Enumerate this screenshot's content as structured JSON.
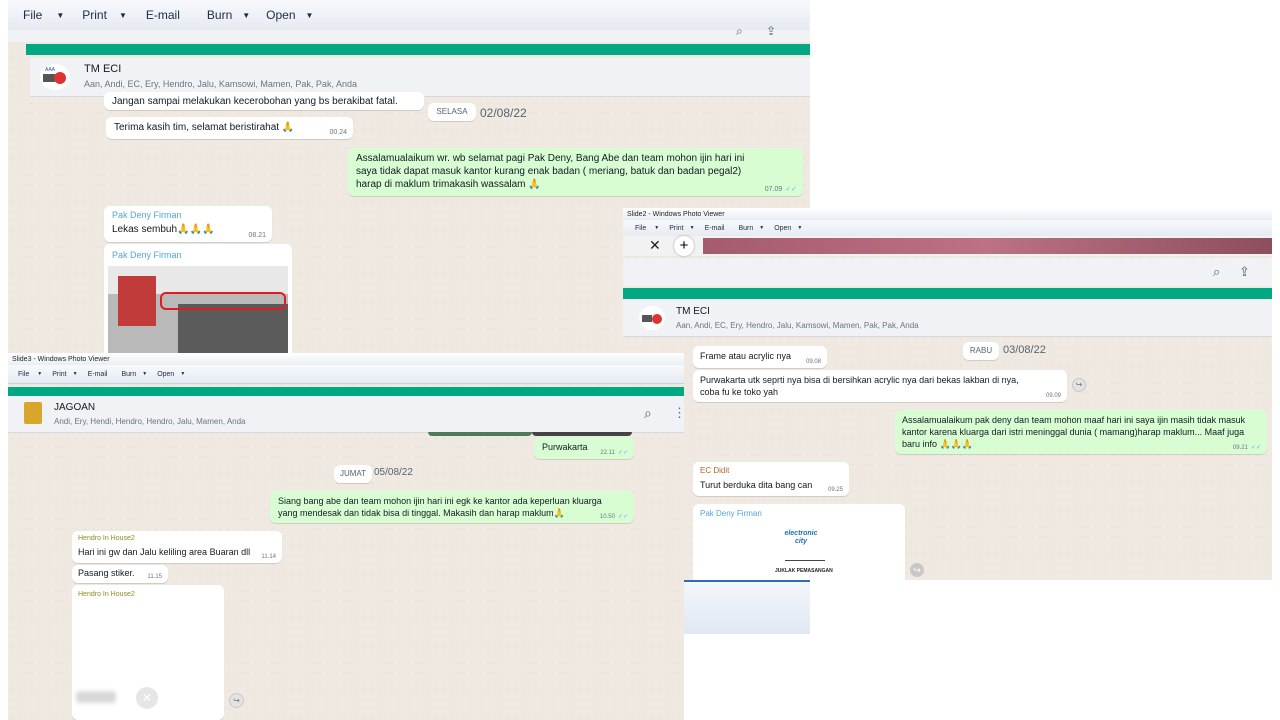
{
  "viewer1": {
    "toolbar": {
      "file": "File",
      "print": "Print",
      "email": "E-mail",
      "burn": "Burn",
      "open": "Open"
    },
    "group": {
      "name": "TM ECI",
      "members": "Aan, Andi, EC, Ery, Hendro, Jalu, Kamsowi, Mamen, Pak, Pak, Anda"
    },
    "messages": {
      "m0": {
        "text": "Jangan sampai melakukan kecerobohan yang bs berakibat fatal."
      },
      "day": {
        "label": "SELASA",
        "date": "02/08/22"
      },
      "m1": {
        "text": "Terima kasih tim, selamat beristirahat 🙏",
        "time": "00.24"
      },
      "m2": {
        "text": "Assalamualaikum wr. wb selamat pagi Pak Deny,  Bang Abe dan team mohon ijin hari ini saya tidak dapat masuk kantor kurang enak badan ( meriang,  batuk dan badan pegal2) harap di maklum trimakasih wassalam 🙏",
        "time": "07.09"
      },
      "m3": {
        "sender": "Pak Deny Firman",
        "text": "Lekas sembuh🙏🙏🙏",
        "time": "08.21"
      },
      "m4": {
        "sender": "Pak Deny Firman"
      }
    }
  },
  "viewer2": {
    "title": "Slide2 - Windows Photo Viewer",
    "toolbar": {
      "file": "File",
      "print": "Print",
      "email": "E-mail",
      "burn": "Burn",
      "open": "Open"
    },
    "group": {
      "name": "TM ECI",
      "members": "Aan, Andi, EC, Ery, Hendro, Jalu, Kamsowi, Mamen, Pak, Pak, Anda"
    },
    "messages": {
      "day": {
        "label": "RABU",
        "date": "03/08/22"
      },
      "m1": {
        "text": "Frame atau acrylic nya",
        "time": "09.08"
      },
      "m2": {
        "text": "Purwakarta utk seprti nya bisa di bersihkan acrylic nya dari bekas lakban di nya, coba fu ke toko yah",
        "time": "09.09"
      },
      "m3": {
        "text": "Assalamualaikum pak deny dan team mohon maaf hari ini saya ijin masih tidak masuk kantor karena kluarga dari istri meninggal dunia ( mamang)harap maklum... Maaf juga baru info 🙏🙏🙏",
        "time": "09.21"
      },
      "m4": {
        "sender": "EC Didit",
        "text": "Turut berduka dita bang can",
        "time": "09.25"
      },
      "m5": {
        "sender": "Pak Deny Firman",
        "logo": "electronic city",
        "caption": "JUKLAK PEMASANGAN"
      }
    }
  },
  "viewer3": {
    "title": "Slide3 - Windows Photo Viewer",
    "toolbar": {
      "file": "File",
      "print": "Print",
      "email": "E-mail",
      "burn": "Burn",
      "open": "Open"
    },
    "group": {
      "name": "JAGOAN",
      "members": "Andi, Ery, Hendi, Hendro, Hendro, Jalu, Mamen, Anda"
    },
    "messages": {
      "m0": {
        "text": "Purwakarta",
        "time": "22.11"
      },
      "day": {
        "label": "JUMAT",
        "date": "05/08/22"
      },
      "m1": {
        "text": "Siang bang abe dan team mohon ijin hari ini egk ke kantor ada keperluan kluarga yang mendesak dan tidak bisa di tinggal. Makasih dan harap maklum🙏",
        "time": "10.50"
      },
      "m2": {
        "sender": "Hendro In House2",
        "text": "Hari ini gw dan Jalu keliling area Buaran dll",
        "time": "11.14"
      },
      "m3": {
        "text": "Pasang stiker.",
        "time": "11.15"
      },
      "m4": {
        "sender": "Hendro In House2"
      }
    }
  },
  "colors": {
    "accent": "#00a884",
    "outgoing": "#d9fdd3",
    "incoming": "#ffffff",
    "sender_blue": "#53a6d6",
    "sender_olive": "#8c8c24",
    "chat_bg": "#efe9e1"
  },
  "icons": [
    "search-icon",
    "menu-icon",
    "share-icon",
    "close-icon",
    "plus-icon",
    "forward-icon",
    "read-ticks-icon"
  ]
}
